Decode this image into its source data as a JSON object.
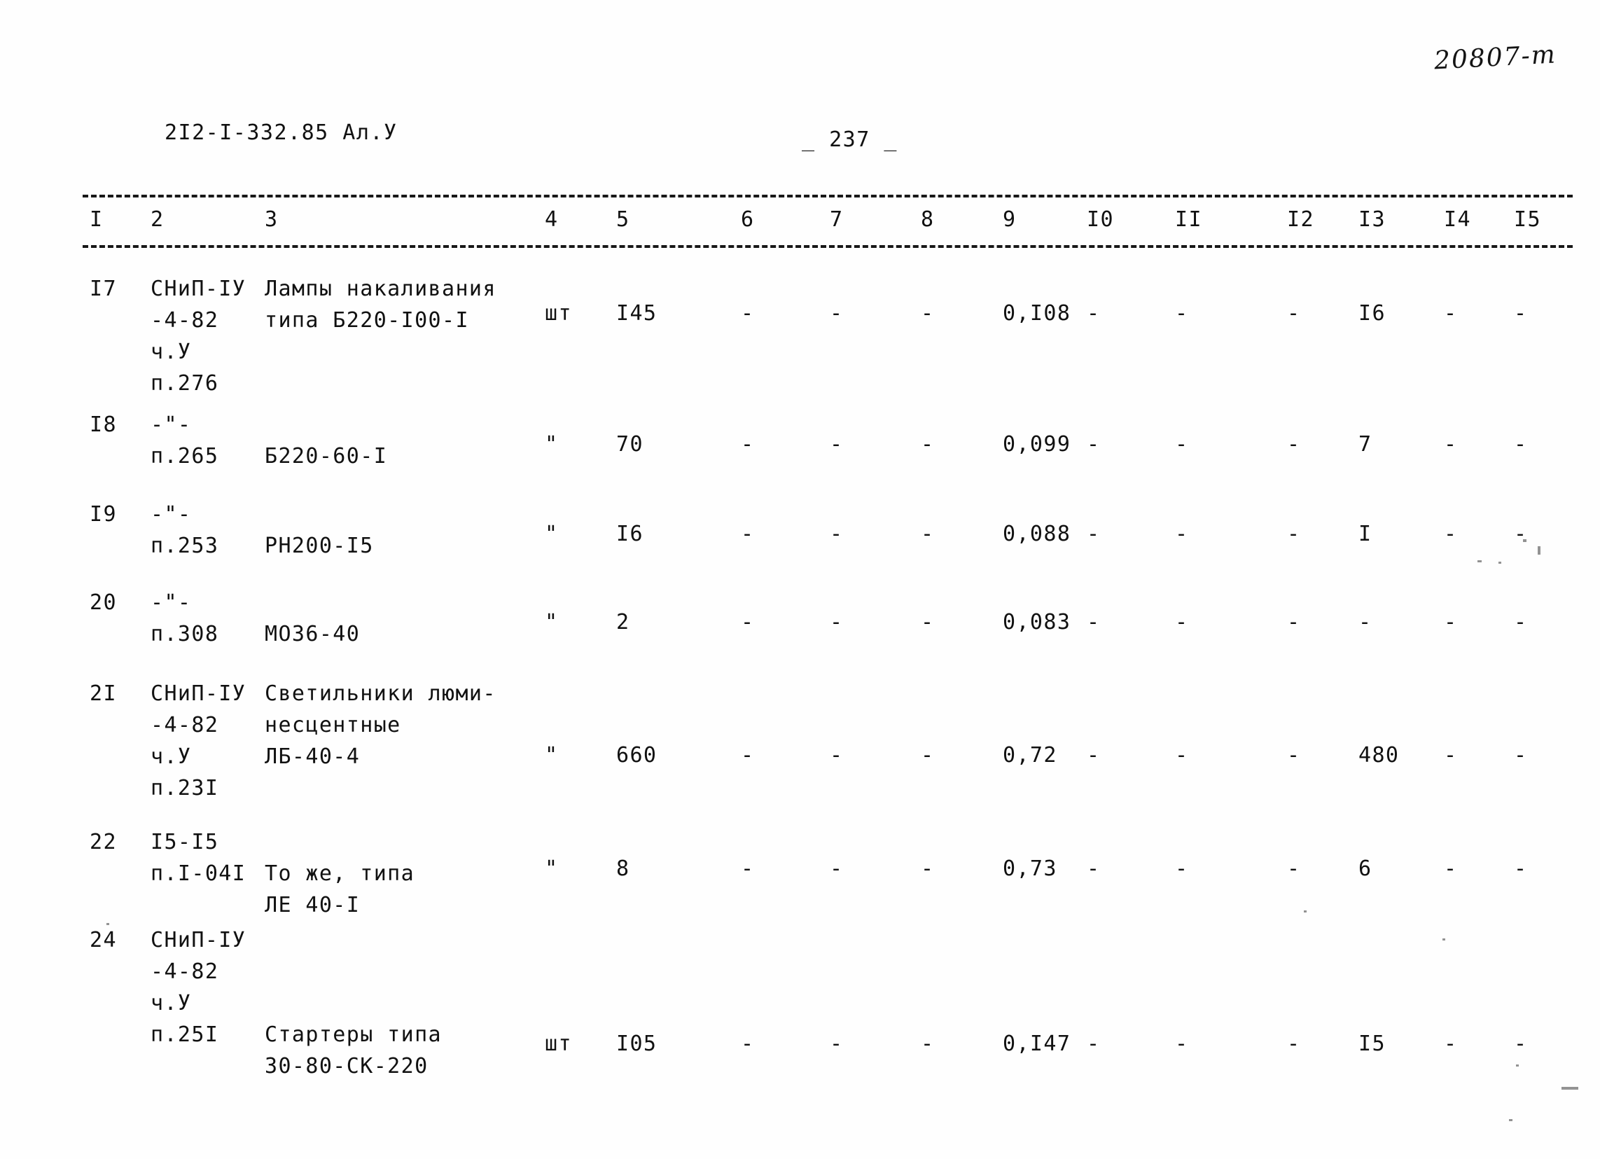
{
  "document": {
    "code": "2I2-I-332.85 Ал.У",
    "page_label": "_ 237 _",
    "archive_number": "20807-т"
  },
  "table": {
    "column_headers": [
      "I",
      "2",
      "3",
      "4",
      "5",
      "6",
      "7",
      "8",
      "9",
      "I0",
      "II",
      "I2",
      "I3",
      "I4",
      "I5"
    ],
    "rows": [
      {
        "no": "I7",
        "norm": [
          "СНиП-IУ",
          "-4-82",
          "ч.У",
          "п.276"
        ],
        "name": [
          "Лампы накаливания",
          "типа Б220-I00-I"
        ],
        "unit": "шт",
        "c5": "I45",
        "c6": "-",
        "c7": "-",
        "c8": "-",
        "c9": "0,I08",
        "c10": "-",
        "c11": "-",
        "c12": "-",
        "c13": "I6",
        "c14": "-",
        "c15": "-"
      },
      {
        "no": "I8",
        "norm": [
          "-\"-",
          "п.265"
        ],
        "name": [
          "Б220-60-I"
        ],
        "unit": "\"",
        "c5": "70",
        "c6": "-",
        "c7": "-",
        "c8": "-",
        "c9": "0,099",
        "c10": "-",
        "c11": "-",
        "c12": "-",
        "c13": "7",
        "c14": "-",
        "c15": "-"
      },
      {
        "no": "I9",
        "norm": [
          "-\"-",
          "п.253"
        ],
        "name": [
          "РН200-I5"
        ],
        "unit": "\"",
        "c5": "I6",
        "c6": "-",
        "c7": "-",
        "c8": "-",
        "c9": "0,088",
        "c10": "-",
        "c11": "-",
        "c12": "-",
        "c13": "I",
        "c14": "-",
        "c15": "-"
      },
      {
        "no": "20",
        "norm": [
          "-\"-",
          "п.308"
        ],
        "name": [
          "МО36-40"
        ],
        "unit": "\"",
        "c5": "2",
        "c6": "-",
        "c7": "-",
        "c8": "-",
        "c9": "0,083",
        "c10": "-",
        "c11": "-",
        "c12": "-",
        "c13": "-",
        "c14": "-",
        "c15": "-"
      },
      {
        "no": "2I",
        "norm": [
          "СНиП-IУ",
          "-4-82",
          "ч.У",
          "п.23I"
        ],
        "name": [
          "Светильники люми-",
          "несцентные",
          "ЛБ-40-4"
        ],
        "unit": "\"",
        "c5": "660",
        "c6": "-",
        "c7": "-",
        "c8": "-",
        "c9": "0,72",
        "c10": "-",
        "c11": "-",
        "c12": "-",
        "c13": "480",
        "c14": "-",
        "c15": "-"
      },
      {
        "no": "22",
        "norm": [
          "I5-I5",
          "п.I-04I"
        ],
        "name": [
          "То же, типа",
          "ЛЕ 40-I"
        ],
        "unit": "\"",
        "c5": "8",
        "c6": "-",
        "c7": "-",
        "c8": "-",
        "c9": "0,73",
        "c10": "-",
        "c11": "-",
        "c12": "-",
        "c13": "6",
        "c14": "-",
        "c15": "-"
      },
      {
        "no": "24",
        "norm": [
          "СНиП-IУ",
          "-4-82",
          "ч.У",
          "п.25I"
        ],
        "name": [
          "Стартеры типа",
          "30-80-СК-220"
        ],
        "unit": "шт",
        "c5": "I05",
        "c6": "-",
        "c7": "-",
        "c8": "-",
        "c9": "0,I47",
        "c10": "-",
        "c11": "-",
        "c12": "-",
        "c13": "I5",
        "c14": "-",
        "c15": "-"
      }
    ]
  },
  "layout": {
    "col_x": {
      "c1": 128,
      "c2": 215,
      "c3": 378,
      "c4": 778,
      "c5": 880,
      "c6": 1058,
      "c7": 1185,
      "c8": 1315,
      "c9": 1432,
      "c10": 1552,
      "c11": 1678,
      "c12": 1838,
      "c13": 1940,
      "c14": 2062,
      "c15": 2162
    },
    "row_tops": [
      390,
      584,
      712,
      838,
      968,
      1180,
      1320
    ],
    "row_value_tops": [
      425,
      612,
      740,
      866,
      1056,
      1218,
      1468
    ]
  }
}
